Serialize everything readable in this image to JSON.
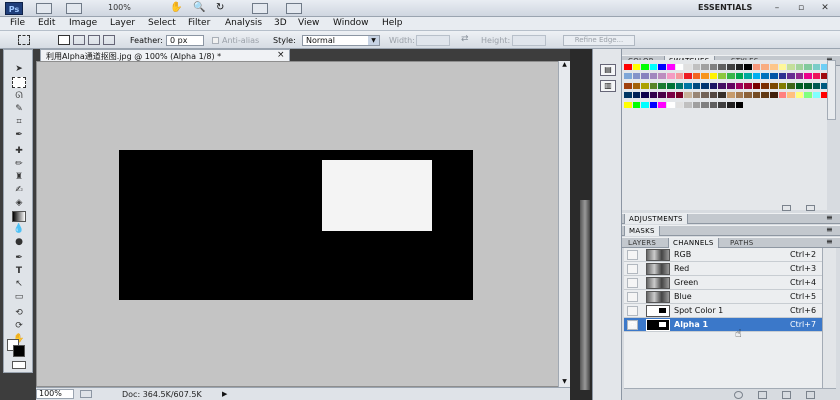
{
  "app": {
    "logo": "Ps",
    "zoom": "100%",
    "workspace": "ESSENTIALS"
  },
  "menu": [
    "File",
    "Edit",
    "Image",
    "Layer",
    "Select",
    "Filter",
    "Analysis",
    "3D",
    "View",
    "Window",
    "Help"
  ],
  "options": {
    "feather_label": "Feather:",
    "feather_value": "0 px",
    "antialias": "Anti-alias",
    "style_label": "Style:",
    "style_value": "Normal",
    "width_label": "Width:",
    "height_label": "Height:",
    "refine_edge": "Refine Edge..."
  },
  "document": {
    "title": "利用Alpha通道抠图.jpg @ 100% (Alpha 1/8) *",
    "close": "×",
    "zoom": "100%",
    "doc_info": "Doc: 364.5K/607.5K"
  },
  "panels": {
    "top_tabs": [
      "COLOR",
      "SWATCHES",
      "STYLES"
    ],
    "adjustments": "ADJUSTMENTS",
    "masks": "MASKS",
    "layer_tabs": [
      "LAYERS",
      "CHANNELS",
      "PATHS"
    ]
  },
  "channels": [
    {
      "name": "RGB",
      "key": "Ctrl+2",
      "selected": false
    },
    {
      "name": "Red",
      "key": "Ctrl+3",
      "selected": false
    },
    {
      "name": "Green",
      "key": "Ctrl+4",
      "selected": false
    },
    {
      "name": "Blue",
      "key": "Ctrl+5",
      "selected": false
    },
    {
      "name": "Spot Color 1",
      "key": "Ctrl+6",
      "selected": false
    },
    {
      "name": "Alpha 1",
      "key": "Ctrl+7",
      "selected": true
    }
  ],
  "colors": {
    "accent": "#3b78c9",
    "canvas_bg": "#000000",
    "selection": "#f4f4f4"
  }
}
